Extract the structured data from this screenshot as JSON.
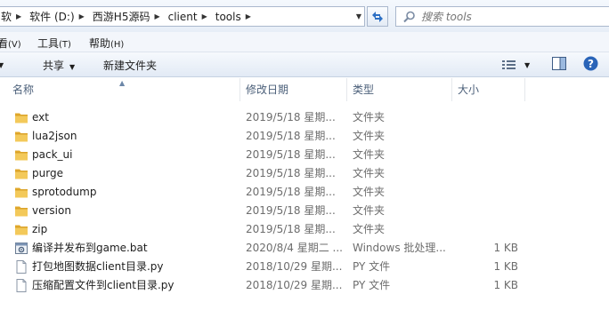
{
  "address": {
    "crumbs": [
      "软件 (D:)",
      "西游H5源码",
      "client",
      "tools"
    ],
    "lead_fragment": "软"
  },
  "search": {
    "placeholder": "搜索 tools"
  },
  "menu": [
    {
      "label": "看",
      "key": "(V)"
    },
    {
      "label": "工具",
      "key": "(T)"
    },
    {
      "label": "帮助",
      "key": "(H)"
    }
  ],
  "toolbar": {
    "share_label": "共享",
    "new_folder_label": "新建文件夹"
  },
  "columns": {
    "name": "名称",
    "date": "修改日期",
    "type": "类型",
    "size": "大小"
  },
  "files": [
    {
      "name": "ext",
      "date": "2019/5/18 星期...",
      "type": "文件夹",
      "size": "",
      "icon": "folder-icon"
    },
    {
      "name": "lua2json",
      "date": "2019/5/18 星期...",
      "type": "文件夹",
      "size": "",
      "icon": "folder-icon"
    },
    {
      "name": "pack_ui",
      "date": "2019/5/18 星期...",
      "type": "文件夹",
      "size": "",
      "icon": "folder-icon"
    },
    {
      "name": "purge",
      "date": "2019/5/18 星期...",
      "type": "文件夹",
      "size": "",
      "icon": "folder-icon"
    },
    {
      "name": "sprotodump",
      "date": "2019/5/18 星期...",
      "type": "文件夹",
      "size": "",
      "icon": "folder-icon"
    },
    {
      "name": "version",
      "date": "2019/5/18 星期...",
      "type": "文件夹",
      "size": "",
      "icon": "folder-icon"
    },
    {
      "name": "zip",
      "date": "2019/5/18 星期...",
      "type": "文件夹",
      "size": "",
      "icon": "folder-icon"
    },
    {
      "name": "编译并发布到game.bat",
      "date": "2020/8/4 星期二 ...",
      "type": "Windows 批处理...",
      "size": "1 KB",
      "icon": "batch-file-icon"
    },
    {
      "name": "打包地图数据client目录.py",
      "date": "2018/10/29 星期...",
      "type": "PY 文件",
      "size": "1 KB",
      "icon": "file-icon"
    },
    {
      "name": "压缩配置文件到client目录.py",
      "date": "2018/10/29 星期...",
      "type": "PY 文件",
      "size": "1 KB",
      "icon": "file-icon"
    }
  ],
  "colors": {
    "folder": "#e8b640",
    "header_text": "#4c607a",
    "meta_text": "#6d6d6d",
    "help": "#2a64b8"
  }
}
